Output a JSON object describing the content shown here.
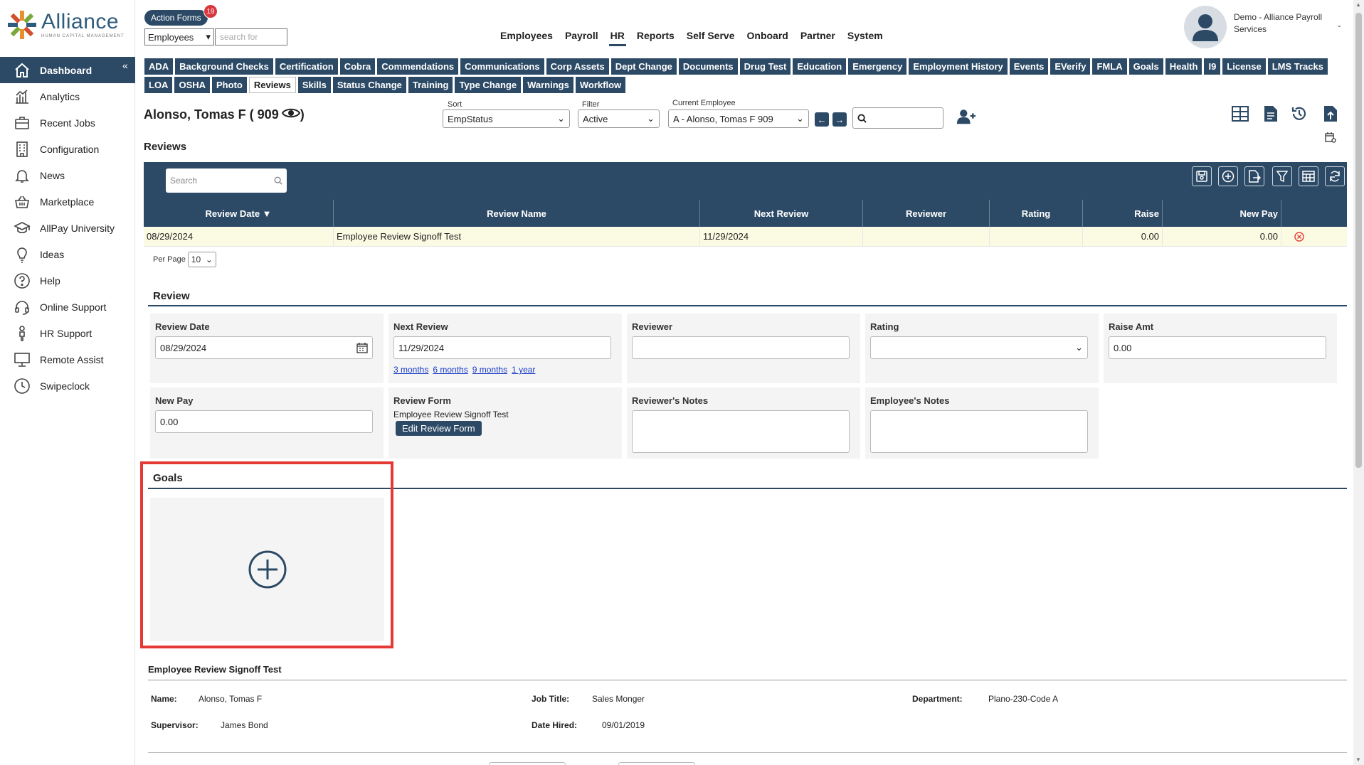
{
  "brand": {
    "name": "Alliance",
    "tagline": "HUMAN CAPITAL MANAGEMENT"
  },
  "sidebar": {
    "items": [
      {
        "label": "Dashboard",
        "icon": "home-icon",
        "active": true
      },
      {
        "label": "Analytics",
        "icon": "analytics-icon"
      },
      {
        "label": "Recent Jobs",
        "icon": "briefcase-icon"
      },
      {
        "label": "Configuration",
        "icon": "building-icon"
      },
      {
        "label": "News",
        "icon": "bell-icon"
      },
      {
        "label": "Marketplace",
        "icon": "basket-icon"
      },
      {
        "label": "AllPay University",
        "icon": "graduation-cap-icon"
      },
      {
        "label": "Ideas",
        "icon": "lightbulb-icon"
      },
      {
        "label": "Help",
        "icon": "question-icon"
      },
      {
        "label": "Online Support",
        "icon": "headset-icon"
      },
      {
        "label": "HR Support",
        "icon": "person-icon"
      },
      {
        "label": "Remote Assist",
        "icon": "monitor-icon"
      },
      {
        "label": "Swipeclock",
        "icon": "clock-icon"
      }
    ]
  },
  "header": {
    "action_forms": "Action Forms",
    "action_forms_count": "19",
    "entity_select": "Employees",
    "search_placeholder": "search for",
    "menu": [
      "Employees",
      "Payroll",
      "HR",
      "Reports",
      "Self Serve",
      "Onboard",
      "Partner",
      "System"
    ],
    "active_menu": "HR",
    "user_name": "Demo - Alliance Payroll Services"
  },
  "tabs": [
    "ADA",
    "Background Checks",
    "Certification",
    "Cobra",
    "Commendations",
    "Communications",
    "Corp Assets",
    "Dept Change",
    "Documents",
    "Drug Test",
    "Education",
    "Emergency",
    "Employment History",
    "Events",
    "EVerify",
    "FMLA",
    "Goals",
    "Health",
    "I9",
    "License",
    "LMS Tracks",
    "LOA",
    "OSHA",
    "Photo",
    "Reviews",
    "Skills",
    "Status Change",
    "Training",
    "Type Change",
    "Warnings",
    "Workflow"
  ],
  "active_tab": "Reviews",
  "employee": {
    "title": "Alonso, Tomas F ( 909",
    "sort_label": "Sort",
    "sort_value": "EmpStatus",
    "filter_label": "Filter",
    "filter_value": "Active",
    "current_label": "Current Employee",
    "current_value": "A - Alonso, Tomas F 909"
  },
  "reviews": {
    "title": "Reviews",
    "search_placeholder": "Search",
    "columns": [
      "Review Date ▼",
      "Review Name",
      "Next Review",
      "Reviewer",
      "Rating",
      "Raise",
      "New Pay"
    ],
    "rows": [
      {
        "review_date": "08/29/2024",
        "review_name": "Employee Review Signoff Test",
        "next_review": "11/29/2024",
        "reviewer": "",
        "rating": "",
        "raise": "0.00",
        "new_pay": "0.00"
      }
    ],
    "per_page_label": "Per Page",
    "per_page_value": "10"
  },
  "review_form": {
    "title": "Review",
    "review_date_label": "Review Date",
    "review_date_value": "08/29/2024",
    "next_review_label": "Next Review",
    "next_review_value": "11/29/2024",
    "quick_links": [
      "3 months",
      "6 months",
      "9 months",
      "1 year"
    ],
    "reviewer_label": "Reviewer",
    "reviewer_value": "",
    "rating_label": "Rating",
    "rating_value": "",
    "raise_label": "Raise Amt",
    "raise_value": "0.00",
    "new_pay_label": "New Pay",
    "new_pay_value": "0.00",
    "review_form_label": "Review Form",
    "review_form_value": "Employee Review Signoff Test",
    "edit_button": "Edit Review Form",
    "reviewer_notes_label": "Reviewer's Notes",
    "employee_notes_label": "Employee's Notes"
  },
  "goals": {
    "title": "Goals"
  },
  "signoff": {
    "title": "Employee Review Signoff Test",
    "name_label": "Name:",
    "name_value": "Alonso, Tomas F",
    "job_title_label": "Job Title:",
    "job_title_value": "Sales Monger",
    "department_label": "Department:",
    "department_value": "Plano-230-Code A",
    "supervisor_label": "Supervisor:",
    "supervisor_value": "James Bond",
    "date_hired_label": "Date Hired:",
    "date_hired_value": "09/01/2019"
  },
  "colors": {
    "primary": "#2c4a66",
    "highlight": "#e53935",
    "row_highlight": "#fbfbe4",
    "badge": "#d9363e"
  }
}
